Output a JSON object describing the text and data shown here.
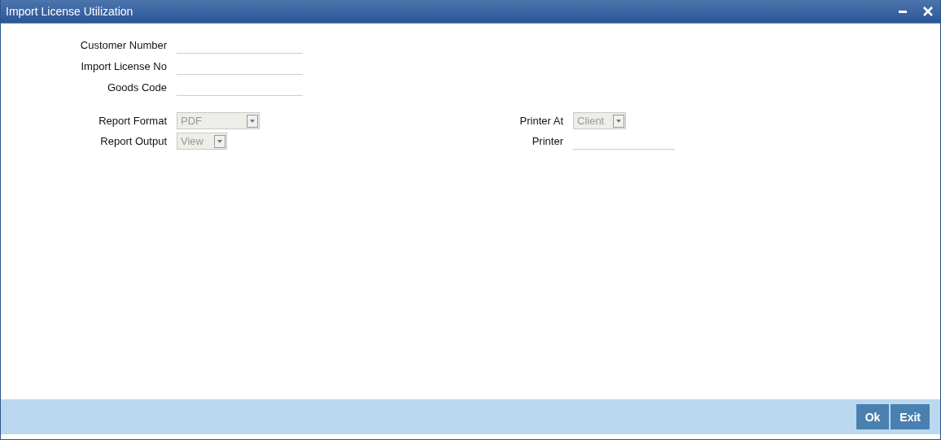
{
  "window": {
    "title": "Import License Utilization",
    "controls": [
      {
        "kind": "minimize"
      },
      {
        "kind": "close"
      }
    ]
  },
  "fields": [
    {
      "label": "Customer Number",
      "kind": "text"
    },
    {
      "label": "Import License No",
      "kind": "text"
    },
    {
      "label": "Goods Code",
      "kind": "text"
    }
  ],
  "report_left": [
    {
      "label": "Report Format",
      "kind": "select",
      "value": "PDF",
      "disabled": true
    },
    {
      "label": "Report Output",
      "kind": "select",
      "value": "View",
      "disabled": true
    }
  ],
  "report_right": [
    {
      "label": "Printer At",
      "kind": "select",
      "value": "Client",
      "disabled": true
    },
    {
      "label": "Printer",
      "kind": "text"
    }
  ],
  "buttons": [
    "Ok",
    "Exit"
  ]
}
